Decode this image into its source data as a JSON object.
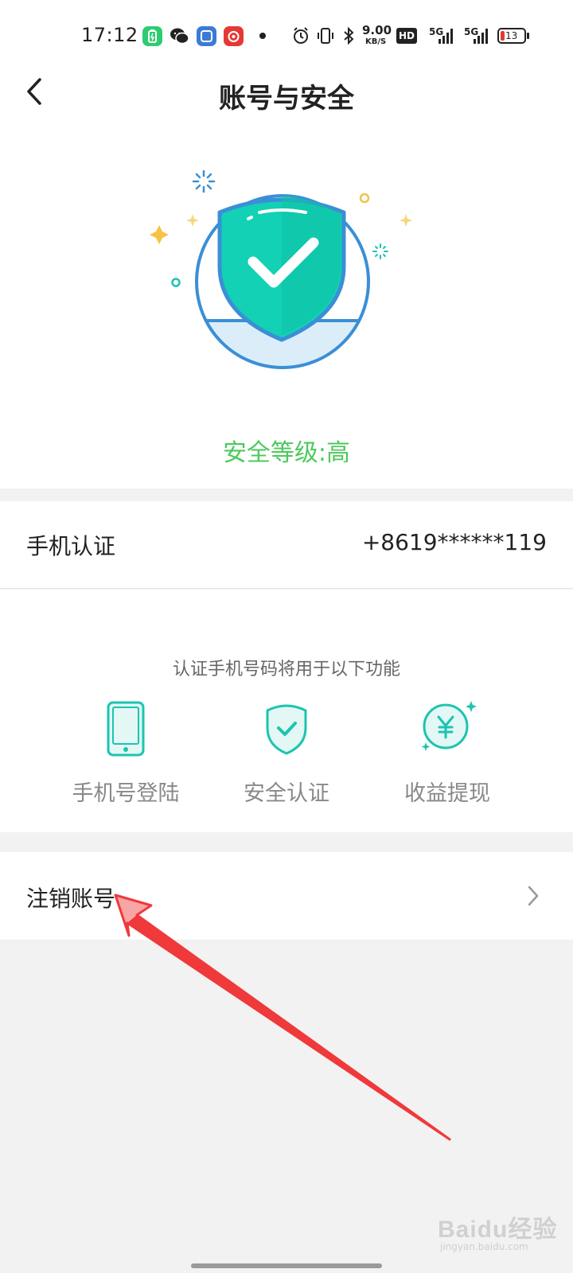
{
  "status_bar": {
    "time": "17:12",
    "net_speed_value": "9.00",
    "net_speed_unit": "KB/S",
    "hd_label": "HD",
    "signal1_label": "5G",
    "signal2_label": "5G",
    "battery_level": "13",
    "app_icons": [
      "battery-saver-icon",
      "wechat-icon",
      "multitask-icon",
      "netease-music-icon"
    ],
    "system_icons": [
      "alarm-icon",
      "vibrate-icon",
      "bluetooth-icon",
      "signal-icon",
      "battery-icon"
    ]
  },
  "header": {
    "title": "账号与安全",
    "back_icon": "chevron-left-icon"
  },
  "hero": {
    "icon": "shield-check-icon",
    "security_level": "安全等级:高"
  },
  "phone_auth": {
    "label": "手机认证",
    "value": "+8619******119"
  },
  "functions": {
    "caption": "认证手机号码将用于以下功能",
    "items": [
      {
        "label": "手机号登陆",
        "icon": "phone-icon"
      },
      {
        "label": "安全认证",
        "icon": "shield-icon"
      },
      {
        "label": "收益提现",
        "icon": "yuan-coin-icon"
      }
    ]
  },
  "cancel_account": {
    "label": "注销账号",
    "icon": "chevron-right-icon"
  },
  "watermark": {
    "logo": "Baidu经验",
    "url": "jingyan.baidu.com"
  },
  "colors": {
    "accent_green": "#4cc95c",
    "teal": "#1cc4b0",
    "shield_teal": "#12d1b4",
    "circle_blue": "#3a8fd6",
    "annotation_red": "#f0393b",
    "background_gray": "#f2f2f2"
  }
}
